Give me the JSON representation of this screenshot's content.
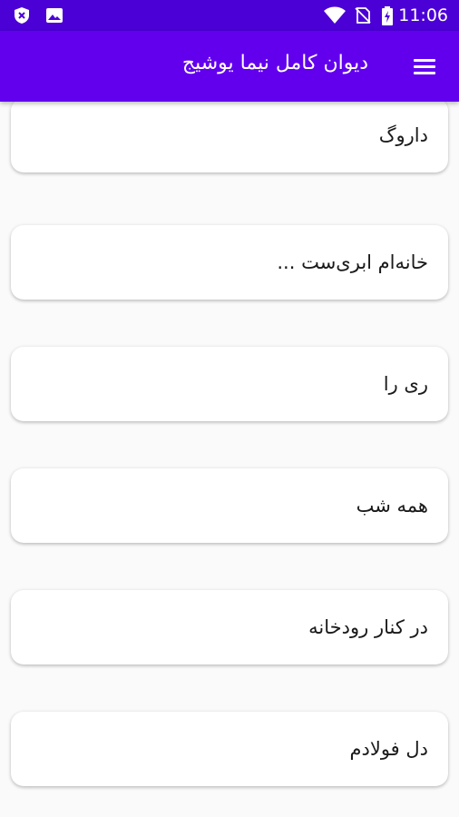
{
  "status_bar": {
    "time": "11:06",
    "left_icons": [
      "shield-icon",
      "image-icon"
    ],
    "right_icons": [
      "wifi-icon",
      "no-sim-icon",
      "battery-charging-icon"
    ]
  },
  "app_bar": {
    "title": "دیوان کامل نیما یوشیج",
    "menu_icon": "menu-icon",
    "background": "#6200ee"
  },
  "poems": [
    {
      "title": "داروگ"
    },
    {
      "title": "خانه‌ام ابری‌ست ..."
    },
    {
      "title": "ری را"
    },
    {
      "title": "همه شب"
    },
    {
      "title": "در کنار رودخانه"
    },
    {
      "title": "دل فولادم"
    }
  ]
}
